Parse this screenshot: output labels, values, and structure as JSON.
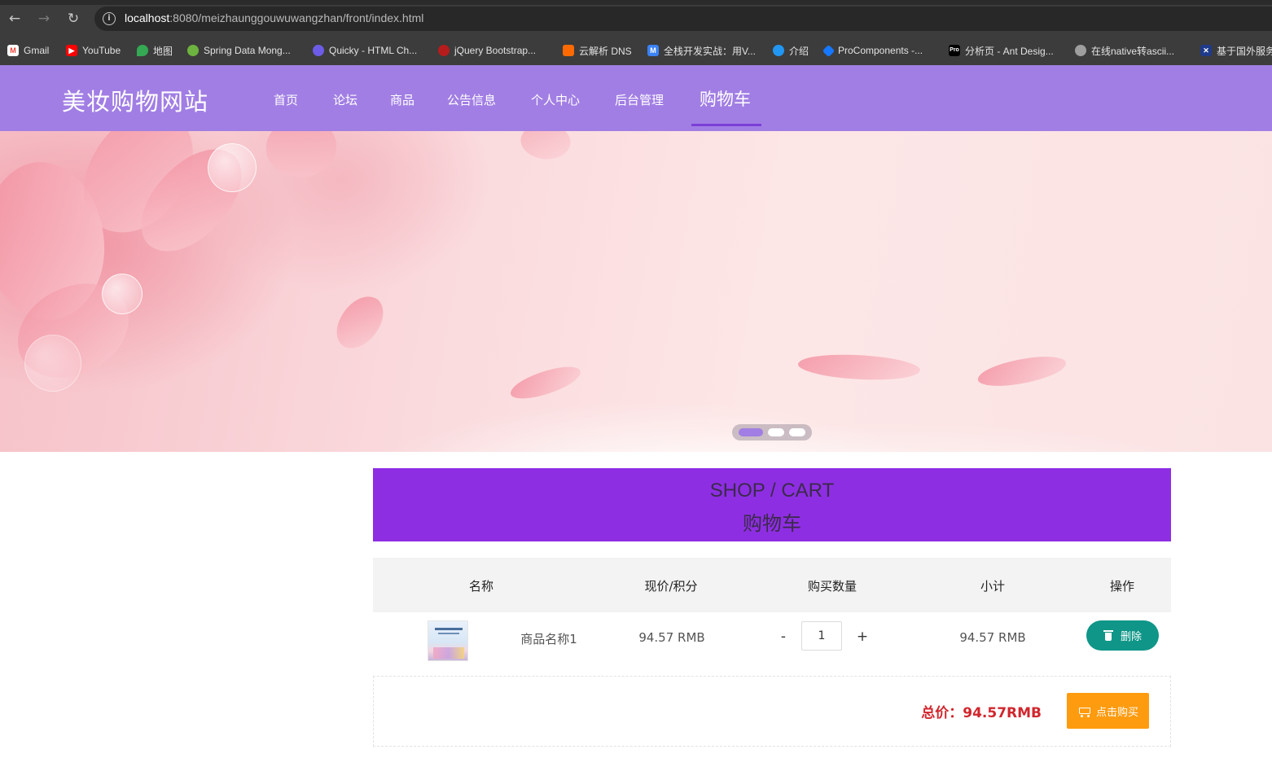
{
  "browser": {
    "url_host": "localhost",
    "url_path": ":8080/meizhaunggouwuwangzhan/front/index.html",
    "bookmarks": [
      {
        "label": "Gmail",
        "icon": "gmail-icon",
        "color": "#ea4335"
      },
      {
        "label": "YouTube",
        "icon": "youtube-icon",
        "color": "#ff0000"
      },
      {
        "label": "地图",
        "icon": "maps-icon",
        "color": "#34a853"
      },
      {
        "label": "Spring Data Mong...",
        "icon": "spring-icon",
        "color": "#6db33f"
      },
      {
        "label": "Quicky - HTML Ch...",
        "icon": "messenger-icon",
        "color": "#6c5ce7"
      },
      {
        "label": "jQuery Bootstrap...",
        "icon": "jquery-icon",
        "color": "#b71c1c"
      },
      {
        "label": "云解析 DNS",
        "icon": "aliyun-icon",
        "color": "#ff6a00"
      },
      {
        "label": "全栈开发实战：用V...",
        "icon": "m-icon",
        "color": "#3b82f6"
      },
      {
        "label": "介绍",
        "icon": "circle-icon",
        "color": "#2196f3"
      },
      {
        "label": "ProComponents -...",
        "icon": "antd-icon",
        "color": "#1677ff"
      },
      {
        "label": "分析页 - Ant Desig...",
        "icon": "pro-icon",
        "color": "#000000"
      },
      {
        "label": "在线native转ascii...",
        "icon": "globe-icon",
        "color": "#9e9e9e"
      },
      {
        "label": "基于国外服务",
        "icon": "flag-icon",
        "color": "#1e3a8a"
      }
    ]
  },
  "site": {
    "logo": "美妆购物网站",
    "nav": [
      "首页",
      "论坛",
      "商品",
      "公告信息",
      "个人中心",
      "后台管理",
      "购物车"
    ],
    "active_nav": "购物车",
    "header_color": "#a17ee4",
    "accent_color": "#8e2ee3"
  },
  "banner": {
    "slide_count": 3,
    "active_slide": 1
  },
  "cart": {
    "title_en": "SHOP / CART",
    "title_cn": "购物车",
    "columns": [
      "名称",
      "现价/积分",
      "购买数量",
      "小计",
      "操作"
    ],
    "items": [
      {
        "name": "商品名称1",
        "price": "94.57 RMB",
        "qty_minus": "-",
        "quantity": "1",
        "qty_plus": "+",
        "subtotal": "94.57 RMB",
        "delete_label": "删除"
      }
    ],
    "total": "总价：94.57RMB",
    "buy_label": "点击购买",
    "delete_color": "#0f9688",
    "buy_color": "#ff9b0f",
    "total_color": "#d1262d"
  }
}
